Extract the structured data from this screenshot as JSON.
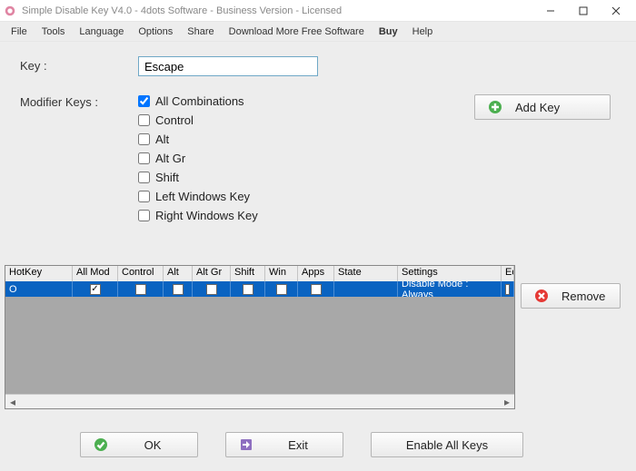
{
  "window": {
    "title": "Simple Disable Key V4.0 - 4dots Software - Business Version - Licensed"
  },
  "menu": {
    "file": "File",
    "tools": "Tools",
    "language": "Language",
    "options": "Options",
    "share": "Share",
    "download": "Download More Free Software",
    "buy": "Buy",
    "help": "Help"
  },
  "form": {
    "key_label": "Key :",
    "key_value": "Escape",
    "mod_label": "Modifier Keys :",
    "mods": {
      "all": "All Combinations",
      "control": "Control",
      "alt": "Alt",
      "altgr": "Alt Gr",
      "shift": "Shift",
      "lwin": "Left Windows Key",
      "rwin": "Right Windows Key"
    },
    "addkey": "Add Key"
  },
  "grid": {
    "headers": {
      "hotkey": "HotKey",
      "allmod": "All Mod",
      "control": "Control",
      "alt": "Alt",
      "altgr": "Alt Gr",
      "shift": "Shift",
      "win": "Win",
      "apps": "Apps",
      "state": "State",
      "settings": "Settings",
      "eq": "Eq"
    },
    "row": {
      "hotkey": "O",
      "allmod": true,
      "control": false,
      "alt": false,
      "altgr": false,
      "shift": false,
      "win": false,
      "apps": false,
      "state": "",
      "settings": "Disable Mode : Always"
    }
  },
  "buttons": {
    "remove": "Remove",
    "ok": "OK",
    "exit": "Exit",
    "enable_all": "Enable All Keys"
  }
}
